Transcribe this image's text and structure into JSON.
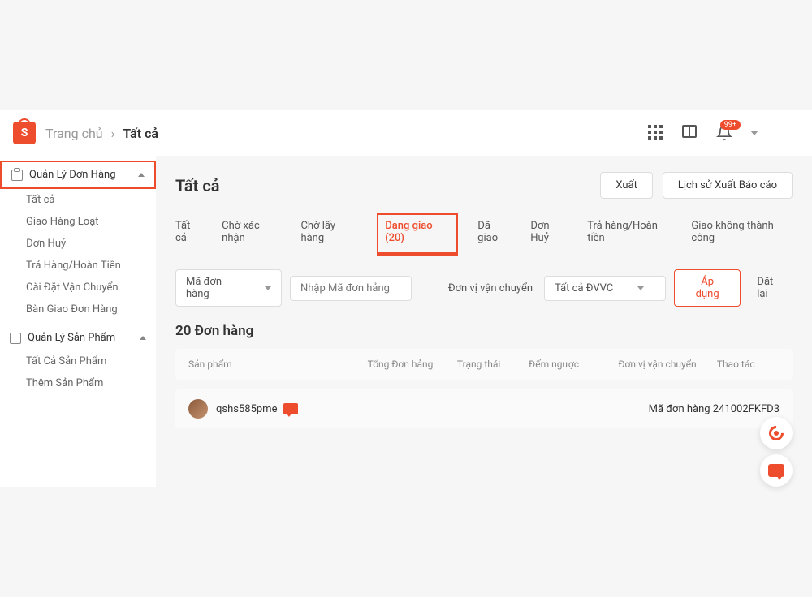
{
  "colors": {
    "accent": "#ee4d2d"
  },
  "header": {
    "logo_letter": "S",
    "breadcrumb_home": "Trang chủ",
    "breadcrumb_current": "Tất cả",
    "notification_badge": "99+"
  },
  "sidebar": {
    "section1": {
      "title": "Quản Lý Đơn Hàng",
      "items": [
        "Tất cả",
        "Giao Hàng Loạt",
        "Đơn Huỷ",
        "Trả Hàng/Hoàn Tiền",
        "Cài Đặt Vận Chuyển",
        "Bàn Giao Đơn Hàng"
      ]
    },
    "section2": {
      "title": "Quản Lý Sản Phẩm",
      "items": [
        "Tất Cả Sản Phẩm",
        "Thêm Sản Phẩm"
      ]
    }
  },
  "main": {
    "title": "Tất cả",
    "export_btn": "Xuất",
    "history_btn": "Lịch sử Xuất Báo cáo",
    "tabs": [
      {
        "label": "Tất cả"
      },
      {
        "label": "Chờ xác nhận"
      },
      {
        "label": "Chờ lấy hàng"
      },
      {
        "label": "Đang giao (20)",
        "active": true
      },
      {
        "label": "Đã giao"
      },
      {
        "label": "Đơn Huỷ"
      },
      {
        "label": "Trả hàng/Hoàn tiền"
      },
      {
        "label": "Giao không thành công"
      }
    ],
    "filters": {
      "order_code_select": "Mã đơn hàng",
      "order_code_placeholder": "Nhập Mã đơn hảng",
      "shipping_unit_label": "Đơn vị vận chuyển",
      "shipping_unit_value": "Tất cả ĐVVC",
      "apply_btn": "Áp dụng",
      "reset_btn": "Đặt lại"
    },
    "count_title": "20 Đơn hàng",
    "table": {
      "cols": {
        "product": "Sản phẩm",
        "total": "Tổng Đơn hảng",
        "status": "Trạng thái",
        "countdown": "Đếm ngược",
        "shipping": "Đơn vị vận chuyển",
        "action": "Thao tác"
      }
    },
    "order": {
      "username": "qshs585pme",
      "order_id_label": "Mã đơn hàng 241002FKFD3"
    }
  }
}
